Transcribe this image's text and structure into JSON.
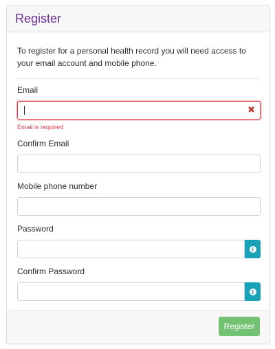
{
  "header": {
    "title": "Register"
  },
  "intro": {
    "text": "To register for a personal health record you will need access to your email account and mobile phone."
  },
  "form": {
    "email": {
      "label": "Email",
      "value": "",
      "error_icon": "times-icon",
      "error_message": "Email is required"
    },
    "confirm_email": {
      "label": "Confirm Email",
      "value": ""
    },
    "mobile": {
      "label": "Mobile phone number",
      "value": ""
    },
    "password": {
      "label": "Password",
      "value": "",
      "info_icon": "info-circle-icon"
    },
    "confirm_password": {
      "label": "Confirm Password",
      "value": "",
      "info_icon": "info-circle-icon"
    }
  },
  "footer": {
    "register_label": "Register"
  },
  "colors": {
    "title": "#6a2c91",
    "error": "#dc3545",
    "info": "#17a2b8",
    "register": "#5cb85c"
  }
}
